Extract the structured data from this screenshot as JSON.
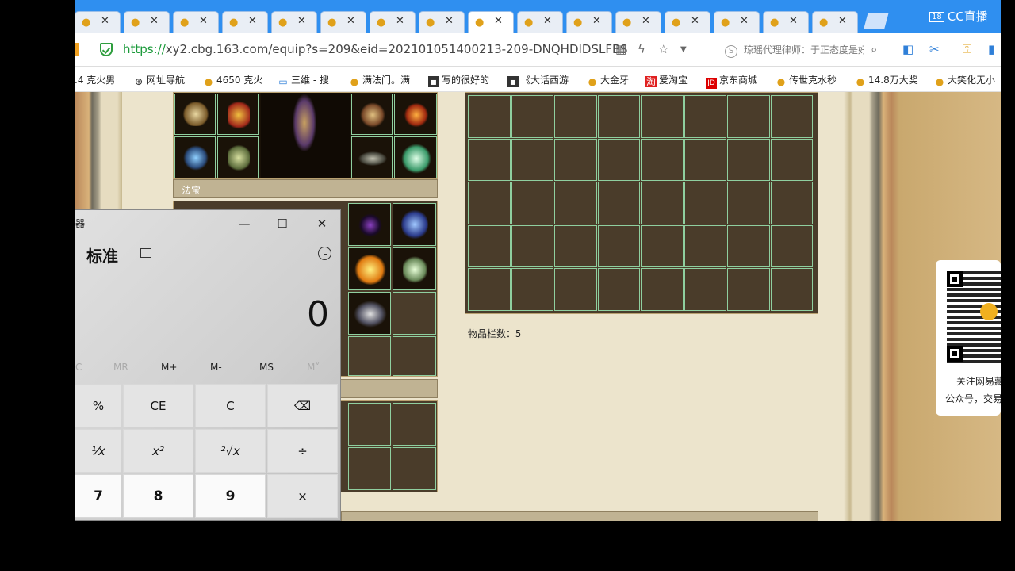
{
  "browser": {
    "tabs": [
      {
        "close": "✕",
        "active": false
      },
      {
        "close": "✕",
        "active": false
      },
      {
        "close": "✕",
        "active": false
      },
      {
        "close": "✕",
        "active": false
      },
      {
        "close": "✕",
        "active": false
      },
      {
        "close": "✕",
        "active": false
      },
      {
        "close": "✕",
        "active": false
      },
      {
        "close": "✕",
        "active": false
      },
      {
        "close": "✕",
        "active": true
      },
      {
        "close": "✕",
        "active": false
      },
      {
        "close": "✕",
        "active": false
      },
      {
        "close": "✕",
        "active": false
      },
      {
        "close": "✕",
        "active": false
      },
      {
        "close": "✕",
        "active": false
      },
      {
        "close": "✕",
        "active": false
      },
      {
        "close": "✕",
        "active": false
      }
    ],
    "live_badge_num": "18",
    "live_badge_text": "CC直播",
    "url_scheme": "https://",
    "url_rest": "xy2.cbg.163.com/equip?s=209&eid=202101051400213-209-DNQHDIDSLFBS",
    "search_hint": "琼瑶代理律师：于正态度是好的",
    "bookmarks": [
      {
        "label": ".4 克火男",
        "icon": ""
      },
      {
        "label": "网址导航",
        "icon": "globe-icon"
      },
      {
        "label": "4650 克火",
        "icon": "chick-icon"
      },
      {
        "label": "三维 - 搜",
        "icon": "tv-icon"
      },
      {
        "label": "满法门。满",
        "icon": "chick-icon"
      },
      {
        "label": "写的很好的",
        "icon": "film-icon"
      },
      {
        "label": "《大话西游",
        "icon": "film-icon"
      },
      {
        "label": "大金牙",
        "icon": "chick-icon"
      },
      {
        "label": "爱淘宝",
        "icon": "taobao-icon"
      },
      {
        "label": "京东商城",
        "icon": "jd-icon"
      },
      {
        "label": "传世克水秒",
        "icon": "chick-icon"
      },
      {
        "label": "14.8万大奖",
        "icon": "chick-icon"
      },
      {
        "label": "大笑化无小",
        "icon": "chick-icon"
      }
    ]
  },
  "game": {
    "fabao_title": "法宝",
    "inventory_count_label": "物品栏数：5",
    "qr_text_line1": "关注网易藏",
    "qr_text_line2": "公众号，交易"
  },
  "calculator": {
    "title": "器",
    "mode": "标准",
    "display": "0",
    "memory": [
      "C",
      "MR",
      "M+",
      "M-",
      "MS",
      "M˅"
    ],
    "memory_dim": [
      true,
      true,
      false,
      false,
      false,
      true
    ],
    "keys": [
      [
        "%",
        "CE",
        "C",
        "⌫"
      ],
      [
        "¹⁄x",
        "x²",
        "²√x",
        "÷"
      ],
      [
        "7",
        "8",
        "9",
        "×"
      ]
    ],
    "win_min": "—",
    "win_max": "☐",
    "win_close": "✕"
  }
}
